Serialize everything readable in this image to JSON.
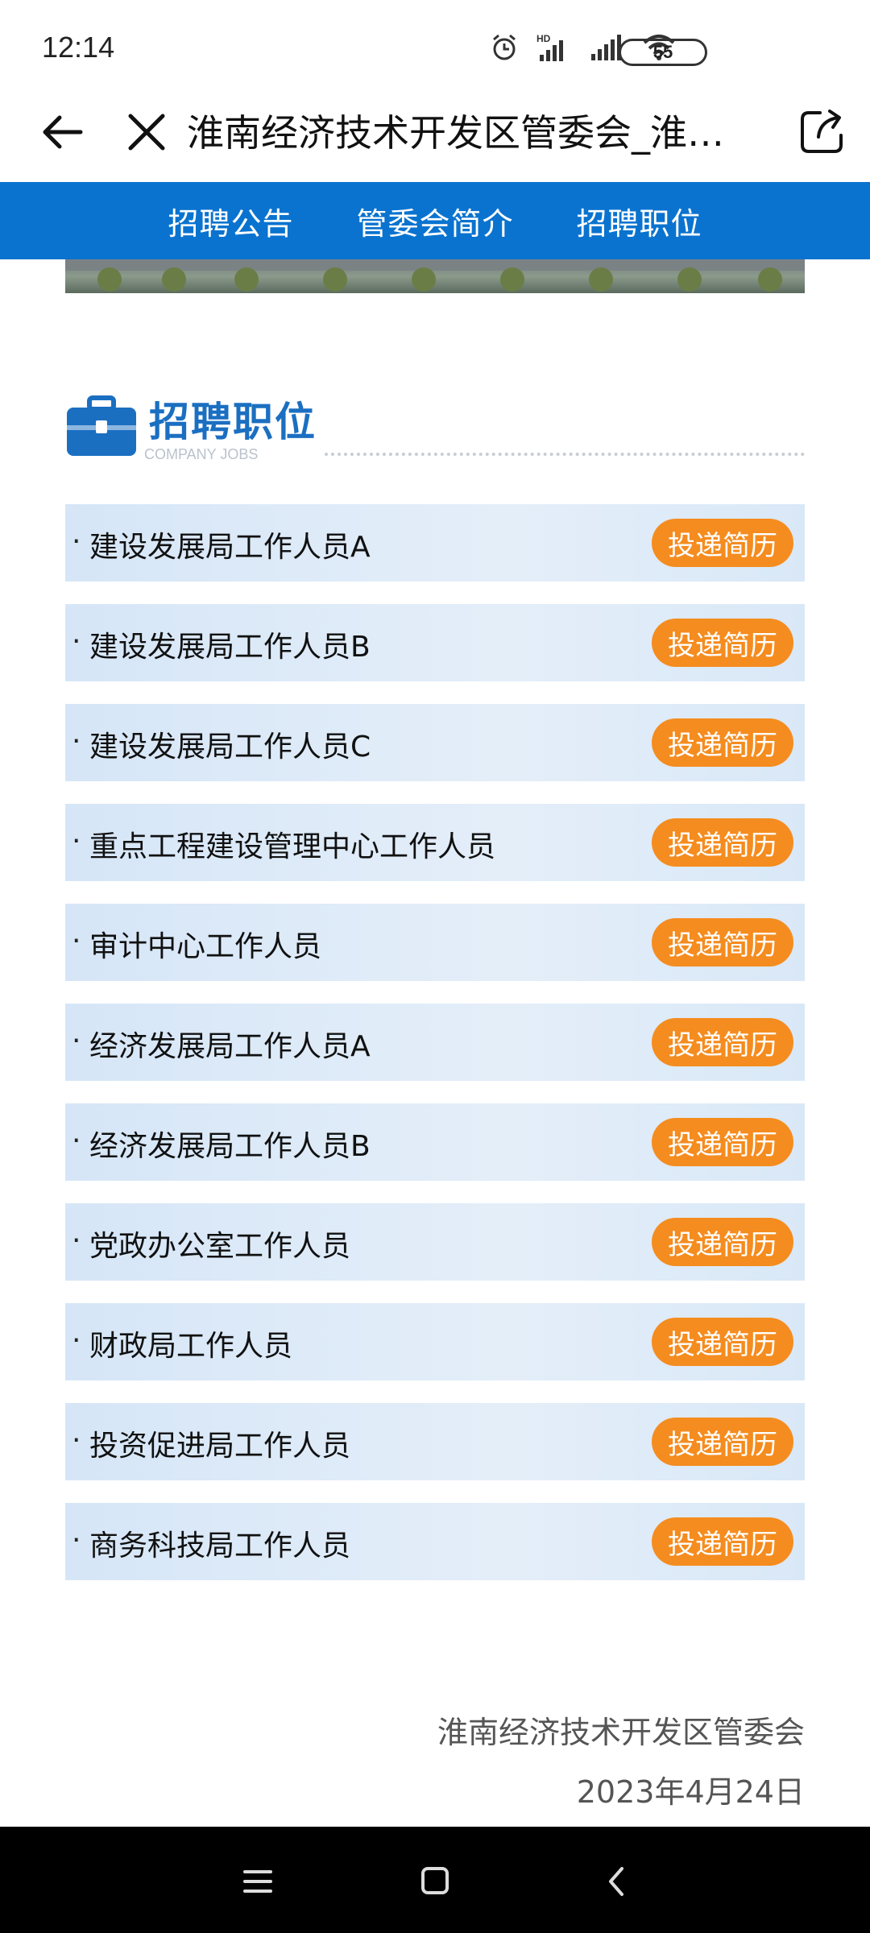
{
  "status_bar": {
    "time": "12:14",
    "battery": "55",
    "icons": [
      "alarm-icon",
      "hd-signal-icon",
      "signal-icon",
      "wifi-icon",
      "battery-icon"
    ]
  },
  "title_bar": {
    "title": "淮南经济技术开发区管委会_淮…",
    "icons": [
      "back-arrow-icon",
      "close-icon",
      "share-icon"
    ]
  },
  "top_nav": {
    "items": [
      {
        "label": "招聘公告"
      },
      {
        "label": "管委会简介"
      },
      {
        "label": "招聘职位"
      }
    ],
    "color": "#0a73cf"
  },
  "section": {
    "title": "招聘职位",
    "subtitle": "COMPANY JOBS",
    "icon": "briefcase-icon"
  },
  "jobs": [
    {
      "title": "建设发展局工作人员A",
      "action": "投递简历"
    },
    {
      "title": "建设发展局工作人员B",
      "action": "投递简历"
    },
    {
      "title": "建设发展局工作人员C",
      "action": "投递简历"
    },
    {
      "title": "重点工程建设管理中心工作人员",
      "action": "投递简历"
    },
    {
      "title": "审计中心工作人员",
      "action": "投递简历"
    },
    {
      "title": "经济发展局工作人员A",
      "action": "投递简历"
    },
    {
      "title": "经济发展局工作人员B",
      "action": "投递简历"
    },
    {
      "title": "党政办公室工作人员",
      "action": "投递简历"
    },
    {
      "title": "财政局工作人员",
      "action": "投递简历"
    },
    {
      "title": "投资促进局工作人员",
      "action": "投递简历"
    },
    {
      "title": "商务科技局工作人员",
      "action": "投递简历"
    }
  ],
  "footer": {
    "org": "淮南经济技术开发区管委会",
    "date": "2023年4月24日"
  },
  "colors": {
    "accent_orange": "#f58c1f",
    "row_bg": "#dbe8f7",
    "title_blue": "#1b6fc1"
  },
  "system_nav": {
    "icons": [
      "menu-icon",
      "home-icon",
      "back-icon"
    ]
  }
}
